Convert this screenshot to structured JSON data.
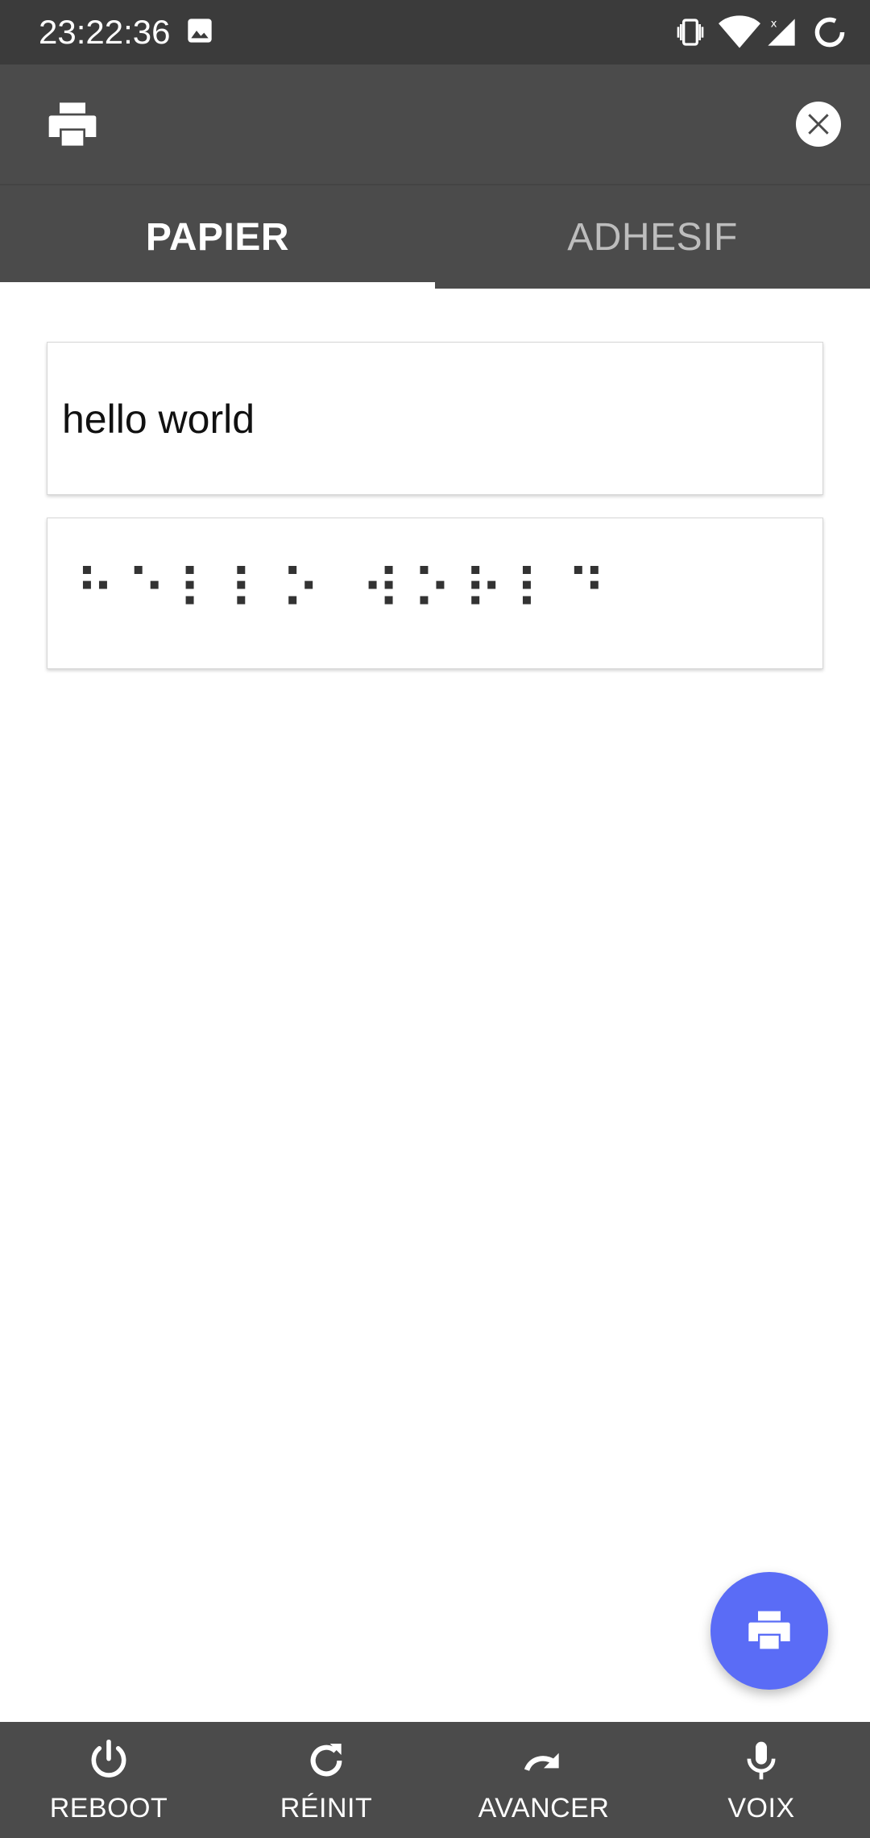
{
  "status_bar": {
    "time": "23:22:36",
    "icons": [
      "gallery-icon",
      "vibrate-icon",
      "wifi-icon",
      "signal-icon",
      "battery-loading-icon"
    ]
  },
  "app_bar": {
    "icons": [
      "printer-icon",
      "close-icon"
    ]
  },
  "tabs": [
    {
      "label": "PAPIER",
      "selected": true
    },
    {
      "label": "ADHESIF",
      "selected": false
    }
  ],
  "text_field": {
    "value": "hello world"
  },
  "braille_field": {
    "value": "⠓⠑⠇⠇⠕ ⠺⠕⠗⠇⠙"
  },
  "fab": {
    "icon": "printer-icon",
    "color": "#5a6cf6"
  },
  "bottom_bar": {
    "items": [
      {
        "label": "REBOOT",
        "icon": "power-icon"
      },
      {
        "label": "RÉINIT",
        "icon": "refresh-icon"
      },
      {
        "label": "AVANCER",
        "icon": "redo-icon"
      },
      {
        "label": "VOIX",
        "icon": "microphone-icon"
      }
    ]
  },
  "colors": {
    "status_bar": "#3b3b3b",
    "app_bar": "#4b4b4b",
    "accent": "#5a6cf6"
  }
}
